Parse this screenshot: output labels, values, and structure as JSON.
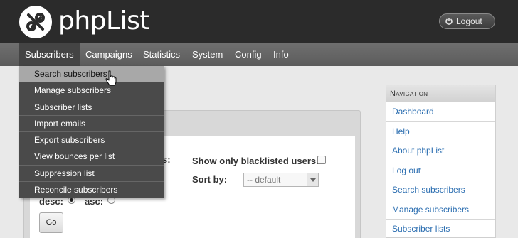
{
  "app": {
    "name": "phpList",
    "logout_label": "Logout"
  },
  "nav": {
    "tabs": [
      {
        "label": "Subscribers"
      },
      {
        "label": "Campaigns"
      },
      {
        "label": "Statistics"
      },
      {
        "label": "System"
      },
      {
        "label": "Config"
      },
      {
        "label": "Info"
      }
    ],
    "active": "Subscribers"
  },
  "dropdown": {
    "items": [
      {
        "label": "Search subscribers"
      },
      {
        "label": "Manage subscribers"
      },
      {
        "label": "Subscriber lists"
      },
      {
        "label": "Import emails"
      },
      {
        "label": "Export subscribers"
      },
      {
        "label": "View bounces per list"
      },
      {
        "label": "Suppression list"
      },
      {
        "label": "Reconcile subscribers"
      }
    ],
    "hovered": "Search subscribers"
  },
  "form": {
    "partial_label": "s:",
    "blacklist_label": "Show only blacklisted users:",
    "sort_by_label": "Sort by:",
    "sort_default": "-- default",
    "desc_label": "desc:",
    "asc_label": "asc:",
    "go_label": "Go"
  },
  "sidebar": {
    "heading": "Navigation",
    "links": [
      {
        "label": "Dashboard"
      },
      {
        "label": "Help"
      },
      {
        "label": "About phpList"
      },
      {
        "label": "Log out"
      },
      {
        "label": "Search subscribers"
      },
      {
        "label": "Manage subscribers"
      },
      {
        "label": "Subscriber lists"
      }
    ]
  },
  "colors": {
    "header_bg": "#2b2b2b",
    "nav_bg": "#666666",
    "dropdown_bg": "#4a4a4a",
    "link": "#2a6db0"
  }
}
